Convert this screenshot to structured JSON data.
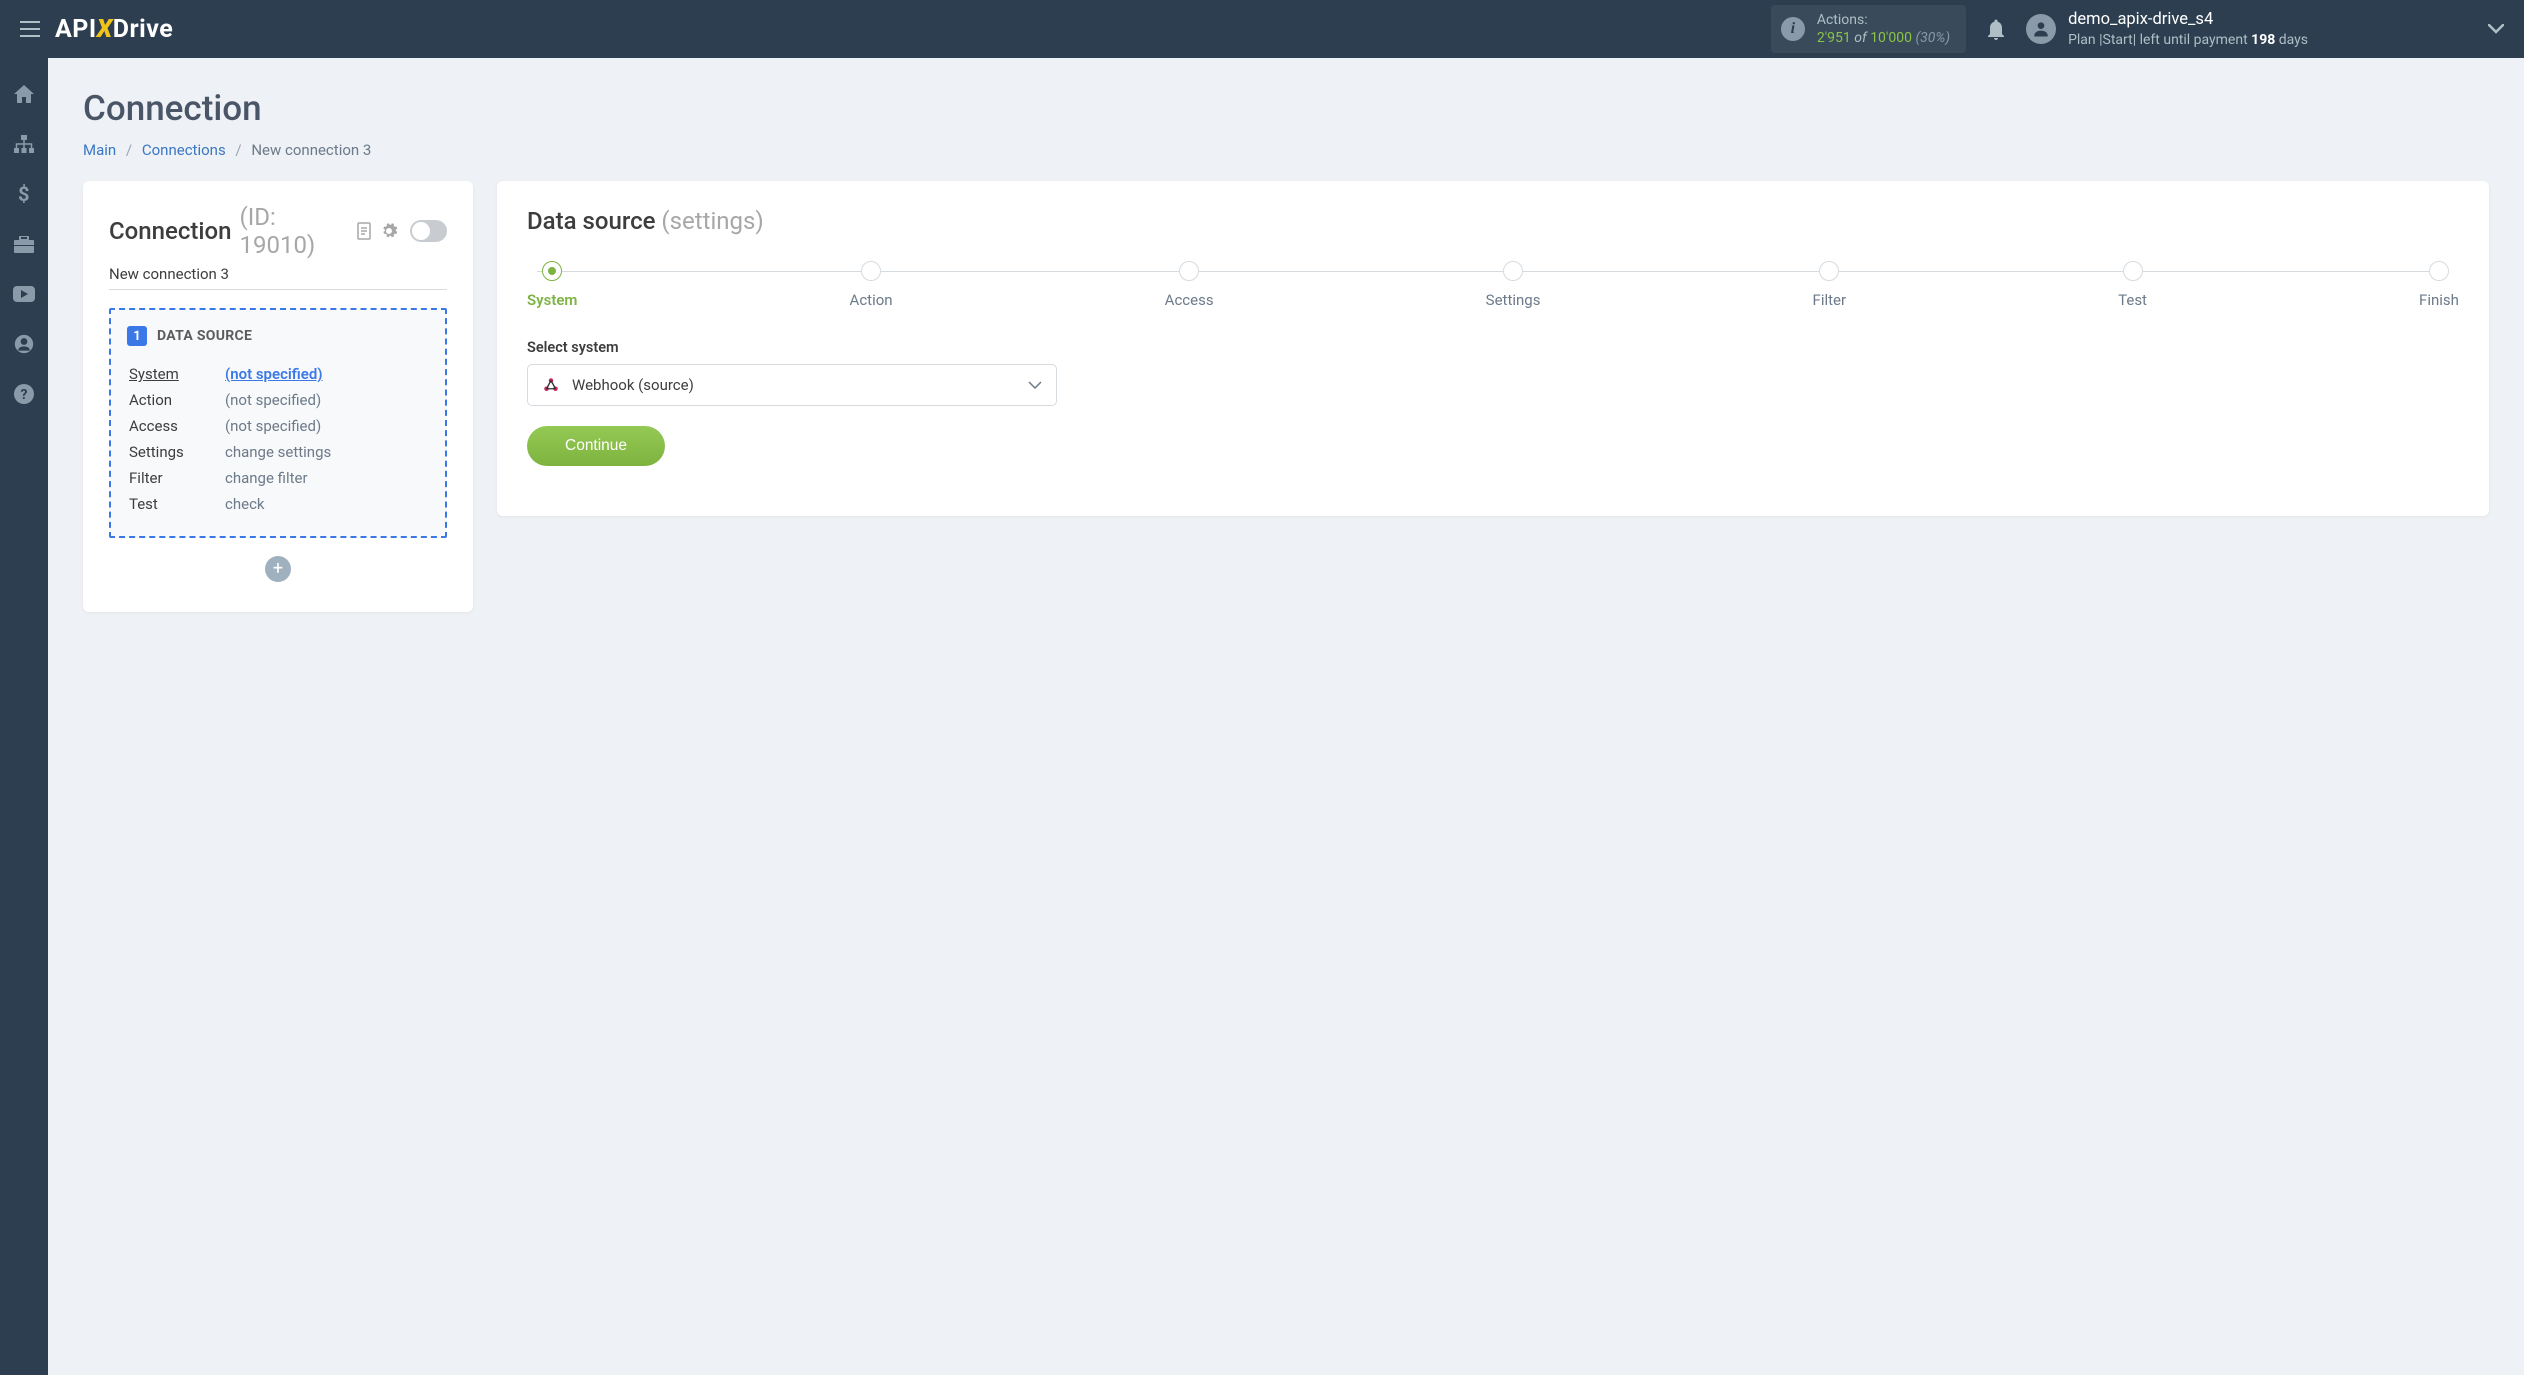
{
  "header": {
    "actions_label": "Actions:",
    "actions_used": "2'951",
    "actions_of": "of",
    "actions_total": "10'000",
    "actions_pct": "(30%)",
    "username": "demo_apix-drive_s4",
    "plan_prefix": "Plan |Start| left until payment ",
    "plan_days": "198",
    "plan_suffix": " days"
  },
  "page": {
    "title": "Connection",
    "crumb_main": "Main",
    "crumb_conn": "Connections",
    "crumb_current": "New connection 3"
  },
  "left": {
    "title": "Connection",
    "id_label": "(ID: 19010)",
    "conn_name": "New connection 3",
    "badge": "1",
    "ds_title": "DATA SOURCE",
    "rows": [
      {
        "k": "System",
        "v": "(not specified)",
        "klink": true,
        "vblue": true
      },
      {
        "k": "Action",
        "v": "(not specified)"
      },
      {
        "k": "Access",
        "v": "(not specified)"
      },
      {
        "k": "Settings",
        "v": "change settings"
      },
      {
        "k": "Filter",
        "v": "change filter"
      },
      {
        "k": "Test",
        "v": "check"
      }
    ]
  },
  "right": {
    "title_dark": "Data source",
    "title_light": "(settings)",
    "steps": [
      "System",
      "Action",
      "Access",
      "Settings",
      "Filter",
      "Test",
      "Finish"
    ],
    "form_label": "Select system",
    "select_value": "Webhook (source)",
    "continue": "Continue"
  }
}
